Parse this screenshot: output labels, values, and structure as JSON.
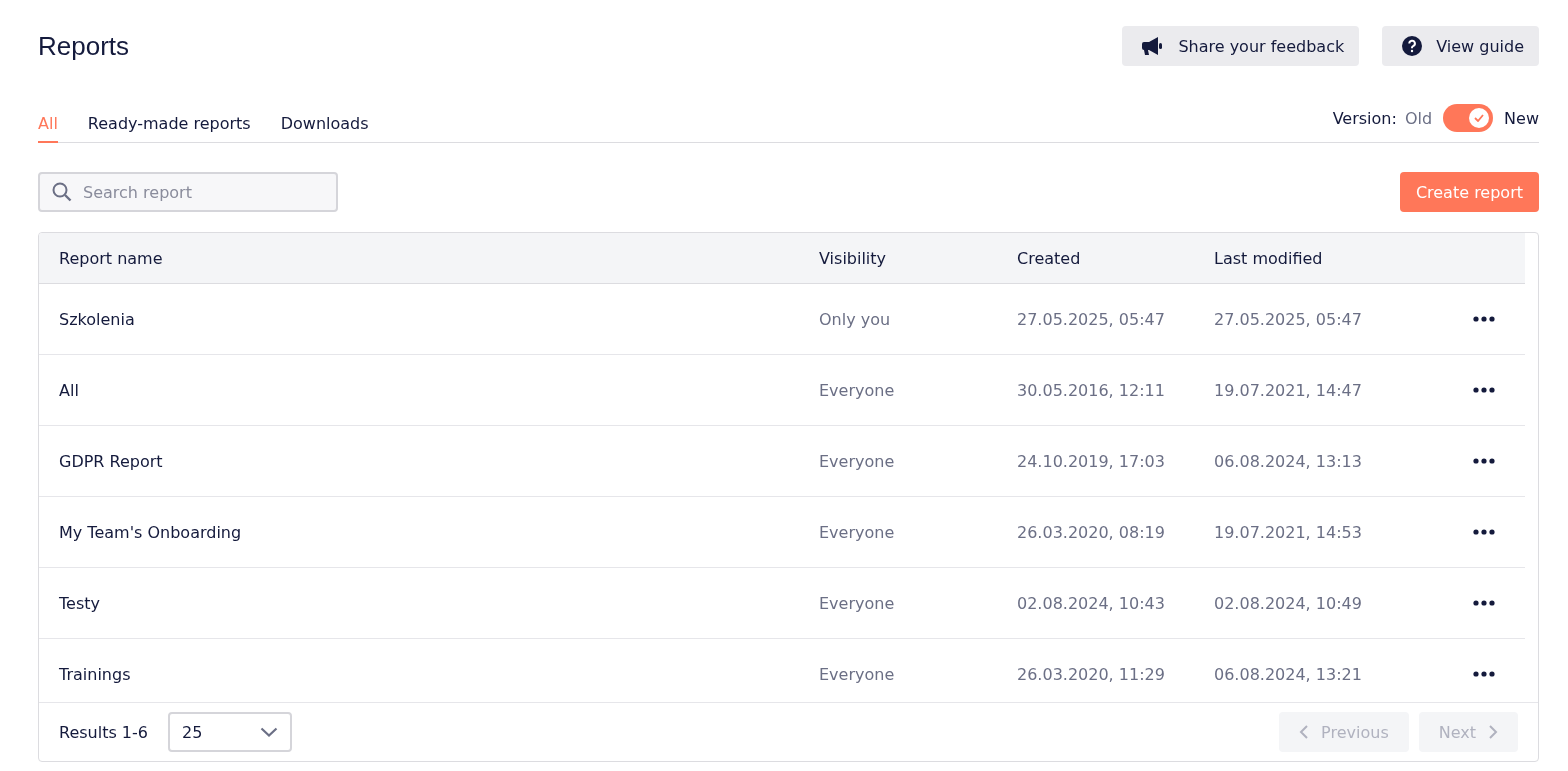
{
  "header": {
    "title": "Reports",
    "buttons": [
      {
        "kind": "feedback",
        "label": "Share your feedback"
      },
      {
        "kind": "guide",
        "label": "View guide"
      }
    ]
  },
  "tabs": [
    {
      "label": "All",
      "selected": true
    },
    {
      "label": "Ready-made reports",
      "selected": false
    },
    {
      "label": "Downloads",
      "selected": false
    }
  ],
  "version": {
    "label": "Version:",
    "off_label": "Old",
    "on_label": "New",
    "on": true
  },
  "search": {
    "placeholder": "Search report"
  },
  "create_button": "Create report",
  "table": {
    "columns": [
      "Report name",
      "Visibility",
      "Created",
      "Last modified"
    ],
    "rows": [
      {
        "name": "Szkolenia",
        "visibility": "Only you",
        "created": "27.05.2025, 05:47",
        "modified": "27.05.2025, 05:47"
      },
      {
        "name": "All",
        "visibility": "Everyone",
        "created": "30.05.2016, 12:11",
        "modified": "19.07.2021, 14:47"
      },
      {
        "name": "GDPR Report",
        "visibility": "Everyone",
        "created": "24.10.2019, 17:03",
        "modified": "06.08.2024, 13:13"
      },
      {
        "name": "My Team's Onboarding",
        "visibility": "Everyone",
        "created": "26.03.2020, 08:19",
        "modified": "19.07.2021, 14:53"
      },
      {
        "name": "Testy",
        "visibility": "Everyone",
        "created": "02.08.2024, 10:43",
        "modified": "02.08.2024, 10:49"
      },
      {
        "name": "Trainings",
        "visibility": "Everyone",
        "created": "26.03.2020, 11:29",
        "modified": "06.08.2024, 13:21"
      }
    ]
  },
  "footer": {
    "results": "Results 1-6",
    "page_size": "25",
    "previous": {
      "label": "Previous",
      "disabled": true
    },
    "next": {
      "label": "Next",
      "disabled": true
    }
  }
}
